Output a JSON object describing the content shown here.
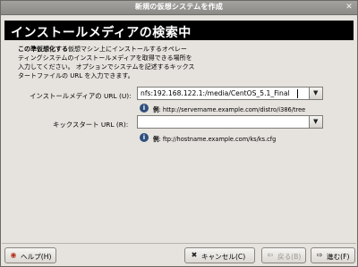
{
  "window": {
    "title": "新規の仮想システムを作成",
    "controls": [
      "×"
    ]
  },
  "banner": {
    "heading": "インストールメディアの検索中"
  },
  "description": {
    "bold_prefix": "この準仮想化する",
    "text_line1": "仮想マシン上にインストールするオペレー",
    "text_line2": "ティングシステムのインストールメディアを取得できる場所を",
    "text_line3": "入力してください。 オプションでシステムを記述するキックス",
    "text_line4": "タートファイルの URL を入力できます。"
  },
  "install_media": {
    "label": "インストールメディアの URL (U):",
    "value": "nfs:192.168.122.1:/media/CentOS_5.1_Final",
    "hint_prefix": "例",
    "hint_text": ": http://servername.example.com/distro/i386/tree"
  },
  "kickstart": {
    "label": "キックスタート URL (R):",
    "value": "",
    "hint_prefix": "例",
    "hint_text": ": ftp://hostname.example.com/ks/ks.cfg"
  },
  "buttons": {
    "help": "ヘルプ(H)",
    "cancel": "キャンセル(C)",
    "back": "戻る(B)",
    "forward": "進む(F)"
  },
  "colors": {
    "banner_bg": "#000000",
    "info_icon": "#2f4f7d"
  },
  "icons": {
    "help": "help-icon",
    "cancel": "cancel-x-icon",
    "back": "back-arrow-icon",
    "forward": "forward-arrow-icon",
    "info": "info-icon",
    "dropdown": "dropdown-arrow-icon"
  }
}
